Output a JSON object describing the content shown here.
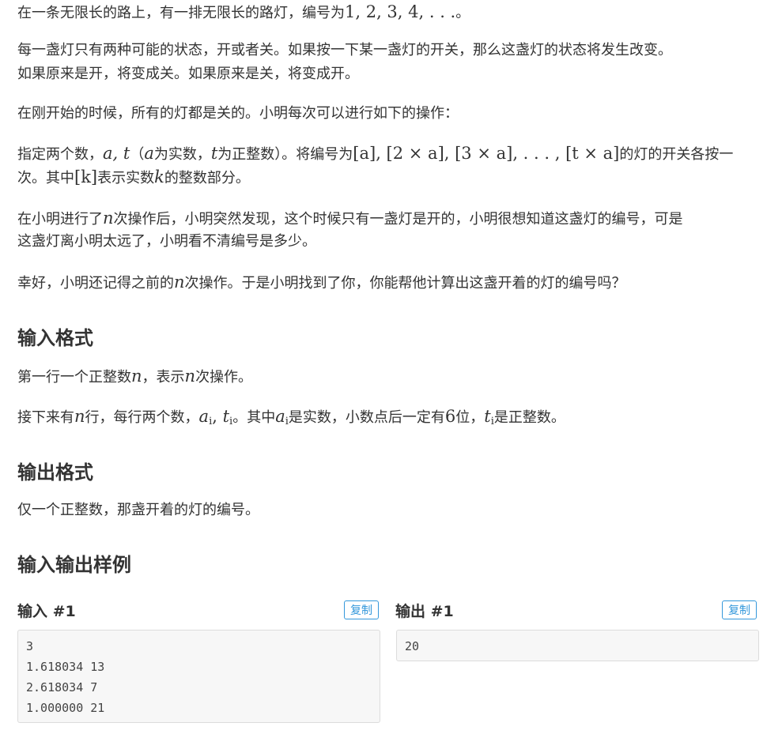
{
  "description": {
    "p1": {
      "text_a": "在一条无限长的路上，有一排无限长的路灯，编号为",
      "math_a": "1, 2, 3, 4, . . .",
      "text_b": "。"
    },
    "p2": {
      "line1": "每一盏灯只有两种可能的状态，开或者关。如果按一下某一盏灯的开关，那么这盏灯的状态将发生改变。",
      "line2": "如果原来是开，将变成关。如果原来是关，将变成开。"
    },
    "p3": {
      "text": "在刚开始的时候，所有的灯都是关的。小明每次可以进行如下的操作："
    },
    "p4": {
      "t1": "指定两个数，",
      "m1": "a, t",
      "t2": "（",
      "m2": "a",
      "t3": "为实数，",
      "m3": "t",
      "t4": "为正整数）。将编号为",
      "m4": "[a], [2 × a], [3 × a], . . . , [t × a]",
      "t5": "的灯的开关各按一",
      "t6": "次。其中",
      "m5": "[k]",
      "t7": "表示实数",
      "m6": "k",
      "t8": "的整数部分。"
    },
    "p5": {
      "t1": "在小明进行了",
      "m1": "n",
      "t2": "次操作后，小明突然发现，这个时候只有一盏灯是开的，小明很想知道这盏灯的编号，可是",
      "line2": "这盏灯离小明太远了，小明看不清编号是多少。"
    },
    "p6": {
      "t1": "幸好，小明还记得之前的",
      "m1": "n",
      "t2": "次操作。于是小明找到了你，你能帮他计算出这盏开着的灯的编号吗？"
    }
  },
  "input_format": {
    "heading": "输入格式",
    "p1": {
      "t1": "第一行一个正整数",
      "m1": "n",
      "t2": "，表示",
      "m2": "n",
      "t3": "次操作。"
    },
    "p2": {
      "t1": "接下来有",
      "m1": "n",
      "t2": "行，每行两个数，",
      "m2a": "a",
      "m2a_sub": "i",
      "m2sep": ", ",
      "m2b": "t",
      "m2b_sub": "i",
      "t3": "。其中",
      "m3": "a",
      "m3_sub": "i",
      "t4": "是实数，小数点后一定有",
      "m4": "6",
      "t5": "位，",
      "m5": "t",
      "m5_sub": "i",
      "t6": "是正整数。"
    }
  },
  "output_format": {
    "heading": "输出格式",
    "text": "仅一个正整数，那盏开着的灯的编号。"
  },
  "samples": {
    "heading": "输入输出样例",
    "input": {
      "title": "输入 #1",
      "copy_label": "复制",
      "lines": [
        "3",
        "1.618034 13",
        "2.618034 7",
        "1.000000 21"
      ]
    },
    "output": {
      "title": "输出 #1",
      "copy_label": "复制",
      "lines": [
        "20"
      ]
    }
  }
}
